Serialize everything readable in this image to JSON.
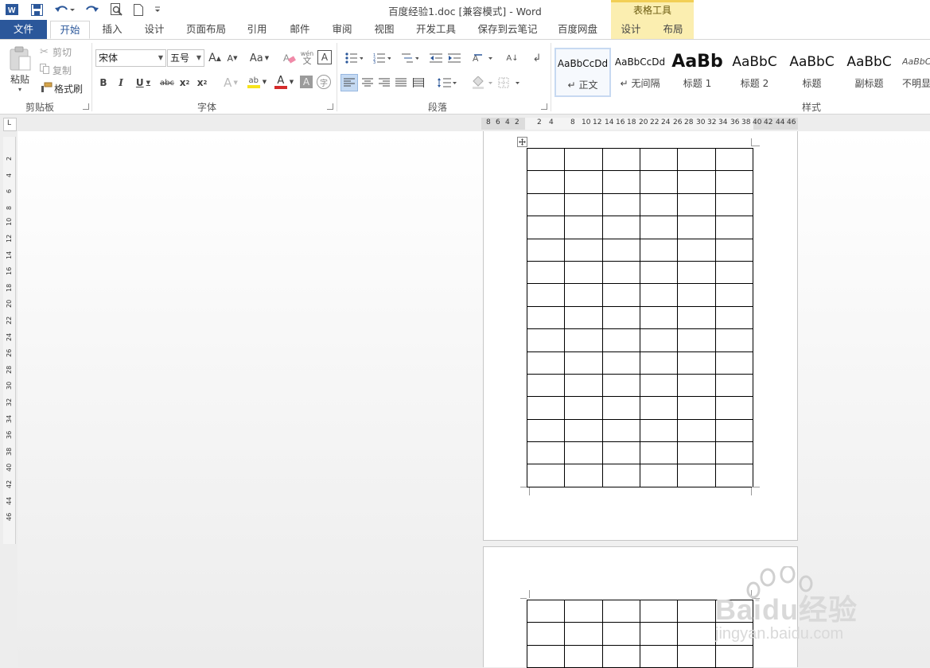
{
  "window": {
    "title": "百度经验1.doc [兼容模式] - Word",
    "contextual_group": "表格工具"
  },
  "tabs": {
    "file": "文件",
    "items": [
      "开始",
      "插入",
      "设计",
      "页面布局",
      "引用",
      "邮件",
      "审阅",
      "视图",
      "开发工具",
      "保存到云笔记",
      "百度网盘"
    ],
    "context_items": [
      "设计",
      "布局"
    ],
    "active": "开始"
  },
  "clipboard": {
    "paste": "粘贴",
    "cut": "剪切",
    "copy": "复制",
    "format_painter": "格式刷",
    "group_label": "剪贴板"
  },
  "font": {
    "family": "宋体",
    "size": "五号",
    "grow_label": "A",
    "shrink_label": "A",
    "case_label": "Aa",
    "bold": "B",
    "italic": "I",
    "underline": "U",
    "strike": "abc",
    "subscript": "x",
    "subscript_sub": "2",
    "superscript": "x",
    "superscript_sup": "2",
    "effects": "A",
    "highlight": "ab",
    "font_color": "A",
    "shading_char": "A",
    "circle_char": "字",
    "pinyin_top": "wén",
    "pinyin_bottom": "文",
    "border_char": "A",
    "group_label": "字体",
    "accent_red": "#d42b2b",
    "highlight_yellow": "#f7e31c"
  },
  "paragraph": {
    "sort_label": "A↓",
    "group_label": "段落"
  },
  "styles": {
    "items": [
      {
        "sample": "AaBbCcDd",
        "name": "正文",
        "prefix": "↵"
      },
      {
        "sample": "AaBbCcDd",
        "name": "无间隔",
        "prefix": "↵"
      },
      {
        "sample": "AaBb",
        "name": "标题 1",
        "prefix": ""
      },
      {
        "sample": "AaBbC",
        "name": "标题 2",
        "prefix": ""
      },
      {
        "sample": "AaBbC",
        "name": "标题",
        "prefix": ""
      },
      {
        "sample": "AaBbC",
        "name": "副标题",
        "prefix": ""
      },
      {
        "sample": "AaBbC",
        "name": "不明显",
        "prefix": ""
      }
    ],
    "group_label": "样式"
  },
  "ruler": {
    "corner": "L",
    "h_ticks": [
      "8",
      "6",
      "4",
      "2",
      "2",
      "4",
      "8",
      "10",
      "12",
      "14",
      "16",
      "18",
      "20",
      "22",
      "24",
      "26",
      "28",
      "30",
      "32",
      "34",
      "36",
      "38",
      "40",
      "42",
      "44",
      "46"
    ],
    "v_ticks": [
      "2",
      "4",
      "6",
      "8",
      "10",
      "12",
      "14",
      "16",
      "18",
      "20",
      "22",
      "24",
      "26",
      "28",
      "30",
      "32",
      "34",
      "36",
      "38",
      "40",
      "42",
      "44",
      "46"
    ]
  },
  "watermark": {
    "brand_line": "Baidu经验",
    "url_line": "jingyan.baidu.com"
  },
  "colors": {
    "file_tab": "#2b579a",
    "context_tab_bg": "#fbeeb0",
    "context_tab_border": "#f2cf55",
    "word_blue": "#2b579a"
  }
}
